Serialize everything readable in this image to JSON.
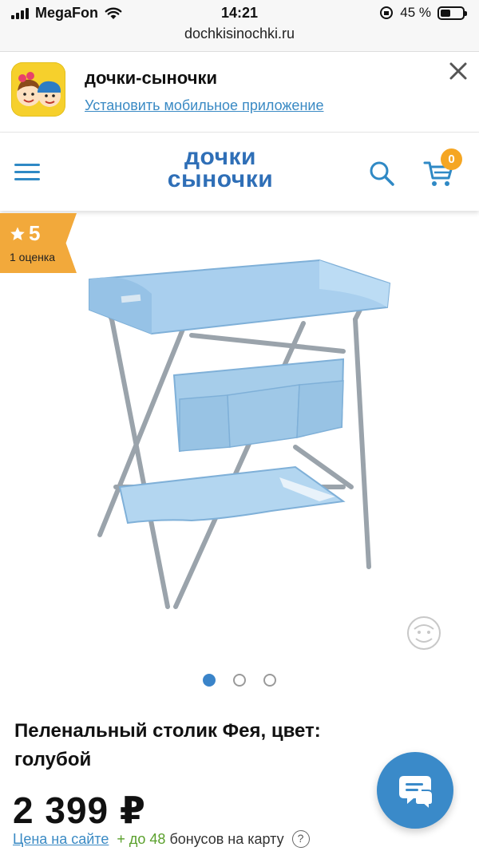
{
  "status_bar": {
    "carrier": "MegaFon",
    "time": "14:21",
    "battery": "45 %",
    "battery_level": 0.45,
    "url": "dochkisinochki.ru"
  },
  "app_banner": {
    "title": "дочки-сыночки",
    "link": "Установить мобильное приложение",
    "icon": "kids-app-icon",
    "close_icon": "close-icon"
  },
  "header": {
    "logo_line1": "дочки",
    "logo_line2": "сыночки",
    "menu_icon": "hamburger-icon",
    "search_icon": "search-icon",
    "cart_icon": "cart-icon",
    "cart_count": "0"
  },
  "rating": {
    "score": "5",
    "count": "1 оценка",
    "icon": "star-icon"
  },
  "gallery": {
    "slides": 3,
    "active_slide": 1
  },
  "product": {
    "title": "Пеленальный столик Фея, цвет: голубой",
    "price": "2 399 ₽",
    "price_link": "Цена на сайте",
    "bonus_prefix": "+ до 48",
    "bonus_suffix": "бонусов на карту",
    "help": "?"
  },
  "chat": {
    "icon": "chat-bubbles-icon"
  },
  "colors": {
    "brand_blue": "#2f6fb7",
    "link_blue": "#3a8ac4",
    "rating_orange": "#f2a93b",
    "badge_orange": "#f5a623",
    "bonus_green": "#5aa02c"
  }
}
